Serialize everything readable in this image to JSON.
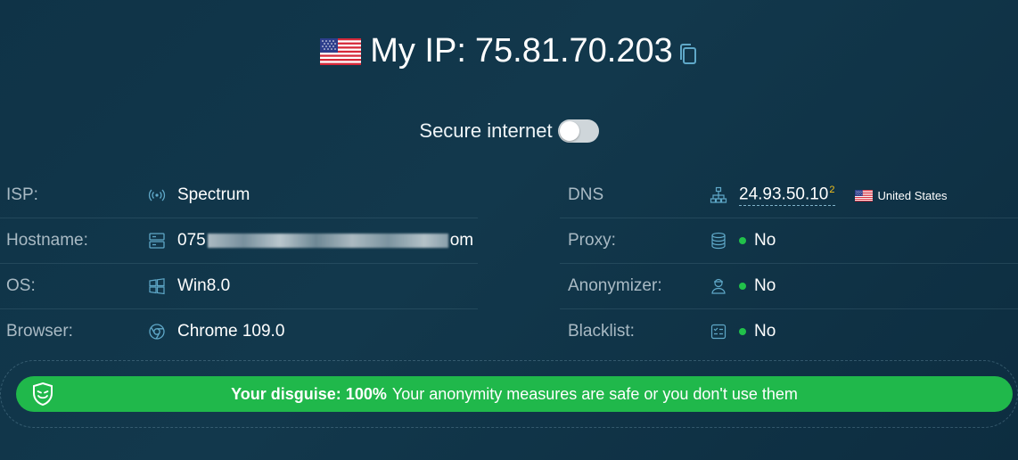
{
  "header": {
    "flag_icon": "us-flag-icon",
    "title_label": "My IP:",
    "ip": "75.81.70.203",
    "copy_icon": "copy-icon"
  },
  "secure": {
    "label": "Secure internet",
    "enabled": false
  },
  "left_rows": [
    {
      "key": "ISP:",
      "icon": "wifi-signal-icon",
      "value": "Spectrum"
    },
    {
      "key": "Hostname:",
      "icon": "server-icon",
      "value_prefix": "075",
      "value_suffix": "om",
      "value_redacted": true
    },
    {
      "key": "OS:",
      "icon": "windows-icon",
      "value": "Win8.0"
    },
    {
      "key": "Browser:",
      "icon": "chrome-icon",
      "value": "Chrome 109.0"
    }
  ],
  "right_rows": [
    {
      "key": "DNS",
      "icon": "network-icon",
      "value": "24.93.50.10",
      "superscript": "2",
      "country": "United States",
      "country_flag": "us-flag-icon"
    },
    {
      "key": "Proxy:",
      "icon": "database-icon",
      "value": "No",
      "status_color": "#21c14a"
    },
    {
      "key": "Anonymizer:",
      "icon": "user-icon",
      "value": "No",
      "status_color": "#21c14a"
    },
    {
      "key": "Blacklist:",
      "icon": "checklist-icon",
      "value": "No",
      "status_color": "#21c14a"
    }
  ],
  "disguise": {
    "icon": "mask-shield-icon",
    "bold": "Your disguise: 100%",
    "text": "Your anonymity measures are safe or you don't use them",
    "color": "#20b84b"
  },
  "colors": {
    "background": "#0f3347",
    "accent_icon": "#5fa8c8",
    "status_green": "#21c14a"
  }
}
